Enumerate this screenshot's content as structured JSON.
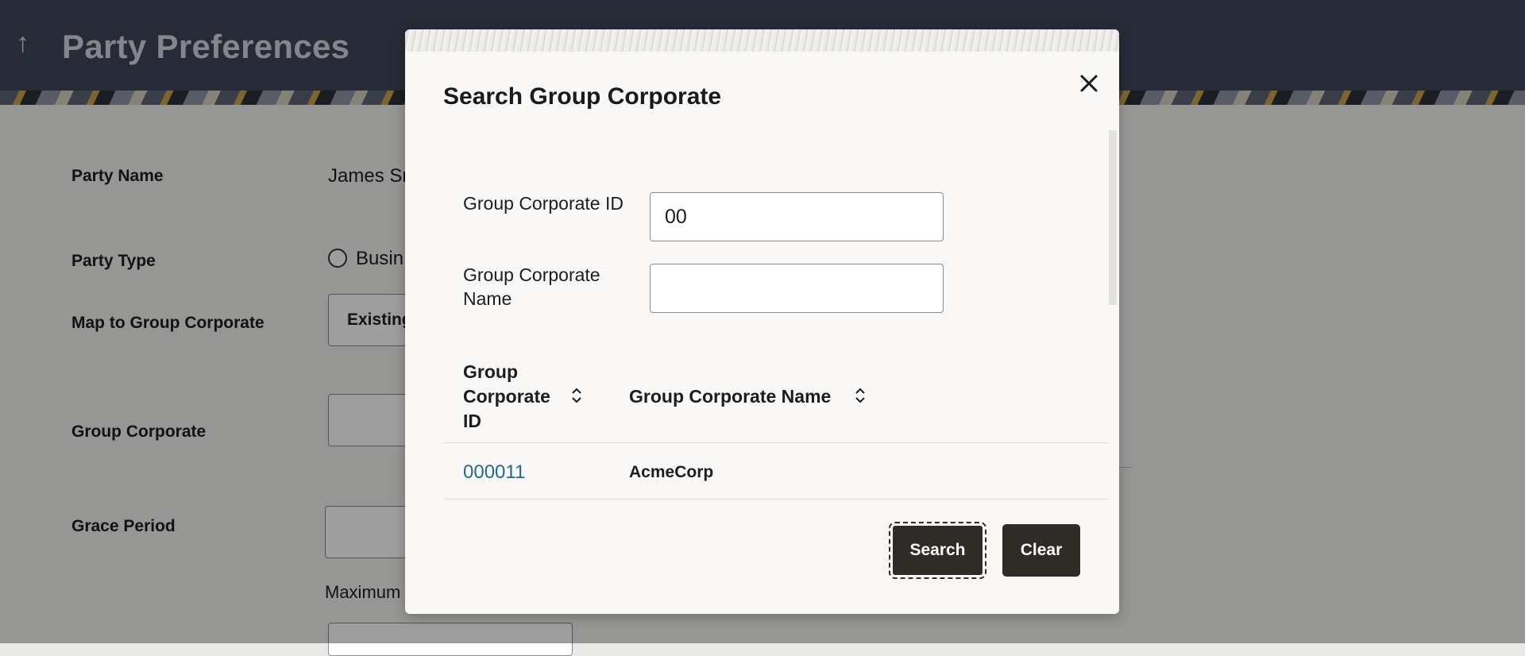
{
  "header": {
    "title": "Party Preferences",
    "back_icon": "up-arrow-icon"
  },
  "form": {
    "party_name_label": "Party Name",
    "party_name_value": "James Sm",
    "party_type_label": "Party Type",
    "party_type_option": "Busin",
    "map_group_label": "Map to Group Corporate",
    "map_group_value": "Existing",
    "group_corporate_label": "Group Corporate",
    "grace_period_label": "Grace Period",
    "maximum_label": "Maximum"
  },
  "modal": {
    "title": "Search Group Corporate",
    "close_icon": "close-icon",
    "id_label": "Group Corporate ID",
    "id_value": "00",
    "name_label_line1": "Group Corporate",
    "name_label_line2": "Name",
    "name_value": "",
    "table": {
      "headers": [
        {
          "line1": "Group",
          "line2": "Corporate",
          "line3": "ID"
        },
        {
          "label": "Group Corporate Name"
        }
      ],
      "rows": [
        {
          "id": "000011",
          "name": "AcmeCorp"
        }
      ]
    },
    "search_label": "Search",
    "clear_label": "Clear"
  }
}
